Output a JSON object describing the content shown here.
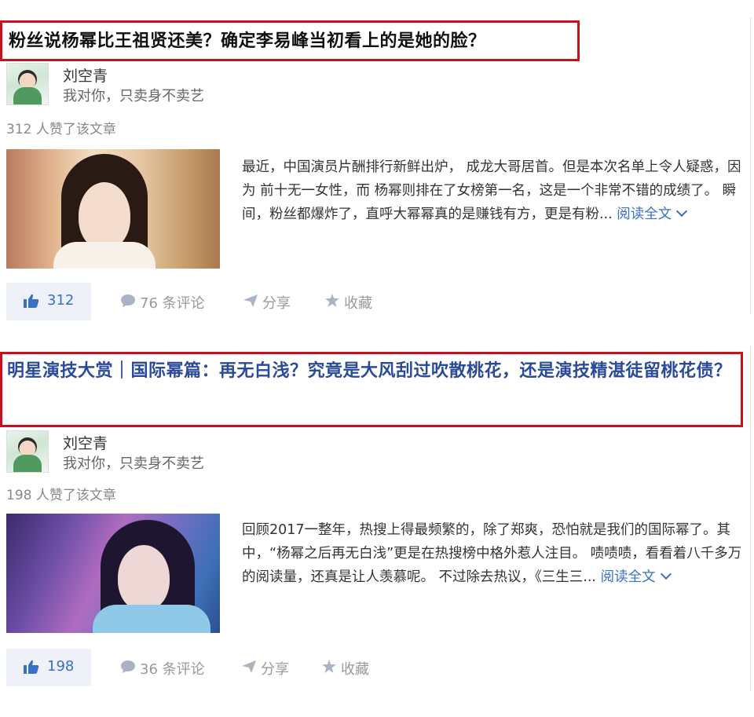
{
  "posts": [
    {
      "title": "粉丝说杨幂比王祖贤还美？确定李易峰当初看上的是她的脸？",
      "author_name": "刘空青",
      "author_signature": "我对你，只卖身不卖艺",
      "likes_text": "312 人赞了该文章",
      "excerpt": "最近，中国演员片酬排行新鲜出炉， 成龙大哥居首。但是本次名单上令人疑惑，因为 前十无一女性，而 杨幂则排在了女榜第一名，这是一个非常不错的成绩了。 瞬间，粉丝都爆炸了，直呼大幂幂真的是赚钱有方，更是有粉...",
      "read_more": "阅读全文",
      "like_count": "312",
      "comments": "76 条评论",
      "share": "分享",
      "favorite": "收藏"
    },
    {
      "title": "明星演技大赏｜国际幂篇：再无白浅？究竟是大风刮过吹散桃花，还是演技精湛徒留桃花债？",
      "author_name": "刘空青",
      "author_signature": "我对你，只卖身不卖艺",
      "likes_text": "198 人赞了该文章",
      "excerpt": "回顾2017一整年，热搜上得最频繁的，除了郑爽，恐怕就是我们的国际幂了。其中，“杨幂之后再无白浅”更是在热搜榜中格外惹人注目。 啧啧啧，看看着八千多万的阅读量，还真是让人羡慕呢。 不过除去热议，《三生三...",
      "read_more": "阅读全文",
      "like_count": "198",
      "comments": "36 条评论",
      "share": "分享",
      "favorite": "收藏"
    }
  ],
  "colors": {
    "highlight_border": "#c8101e",
    "link": "#3a6fc6",
    "title2": "#2a4a9a"
  },
  "icons": [
    "thumbs-up-icon",
    "comment-icon",
    "share-icon",
    "star-icon",
    "chevron-down-icon"
  ]
}
